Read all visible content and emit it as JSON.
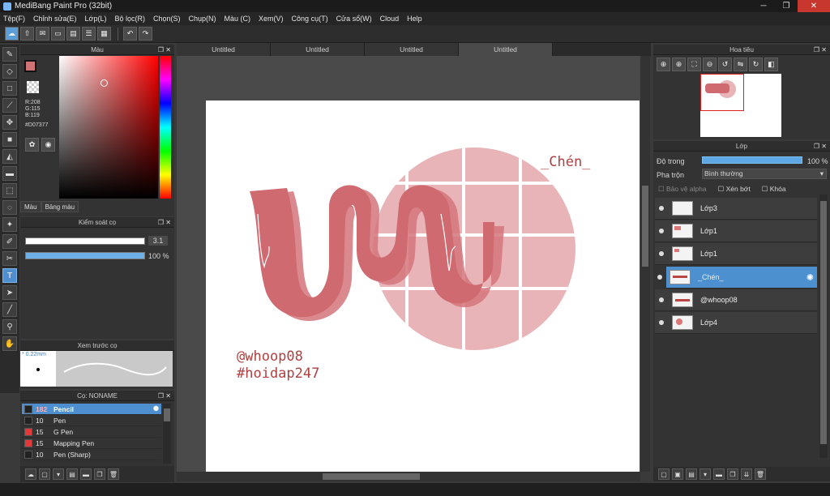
{
  "app": {
    "title": "MediBang Paint Pro (32bit)"
  },
  "menu": [
    "Tệp(F)",
    "Chỉnh sửa(E)",
    "Lớp(L)",
    "Bộ lọc(R)",
    "Chọn(S)",
    "Chụp(N)",
    "Màu (C)",
    "Xem(V)",
    "Công cụ(T)",
    "Cửa sổ(W)",
    "Cloud",
    "Help"
  ],
  "color_panel": {
    "title": "Màu",
    "r": "R:208",
    "g": "G:115",
    "b": "B:119",
    "hex": "#D07377",
    "tab_color": "Màu",
    "tab_palette": "Bảng màu",
    "current_color": "#D07377"
  },
  "brush_control": {
    "title": "Kiểm soát cọ",
    "size": "3.1",
    "opacity": "100 %"
  },
  "brush_preview": {
    "title": "Xem trước cọ",
    "size_label": "* 0.22mm"
  },
  "brush_list": {
    "title": "Cọ: NONAME",
    "items": [
      {
        "size": "182",
        "name": "Pencil",
        "color": "#222222"
      },
      {
        "size": "10",
        "name": "Pen",
        "color": "#222222"
      },
      {
        "size": "15",
        "name": "G Pen",
        "color": "#e03a3a"
      },
      {
        "size": "15",
        "name": "Mapping Pen",
        "color": "#e03a3a"
      },
      {
        "size": "10",
        "name": "Pen (Sharp)",
        "color": "#222222"
      }
    ]
  },
  "doc_tabs": [
    "Untitled",
    "Untitled",
    "Untitled",
    "Untitled"
  ],
  "canvas_text": {
    "title_text": "_Chén_",
    "handle1": "@whoop08",
    "handle2": "#hoidap247"
  },
  "navigator": {
    "title": "Hoa tiêu"
  },
  "layers": {
    "title": "Lớp",
    "opacity_label": "Độ trong",
    "opacity_value": "100 %",
    "opacity_fraction": 1.0,
    "blend_label": "Pha trộn",
    "blend_value": "Bình thường",
    "protect_alpha": "Bảo vệ alpha",
    "clipping": "Xén bớt",
    "lock": "Khóa",
    "items": [
      {
        "name": "Lớp3"
      },
      {
        "name": "Lớp1"
      },
      {
        "name": "Lớp1"
      },
      {
        "name": "_Chén_",
        "selected": true
      },
      {
        "name": "@whoop08"
      },
      {
        "name": "Lớp4"
      }
    ]
  }
}
